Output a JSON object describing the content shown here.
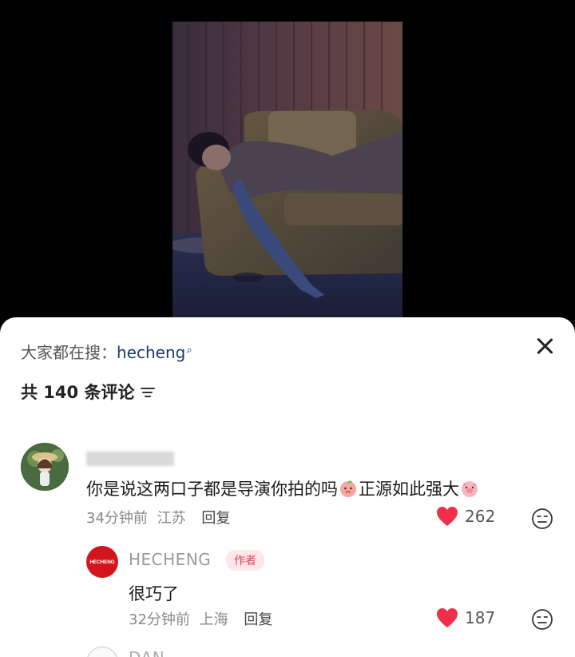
{
  "search_hint": {
    "prefix": "大家都在搜：",
    "keyword": "hecheng",
    "icon": "search-icon"
  },
  "comments_header": {
    "count_label": "共 140 条评论",
    "sort_icon": "sort-filter-icon"
  },
  "comments": [
    {
      "text_part1": "你是说这两口子都是导演你拍的吗",
      "text_part2": "正源如此强大",
      "time": "34分钟前",
      "location": "江苏",
      "reply_label": "回复",
      "likes": "262"
    }
  ],
  "reply": {
    "author": "HECHENG",
    "avatar_text": "HECHENG",
    "author_tag": "作者",
    "text": "很巧了",
    "time": "32分钟前",
    "location": "上海",
    "reply_label": "回复",
    "likes": "187"
  },
  "next_comment": {
    "name_partial": "DAN"
  },
  "colors": {
    "heart": "#f0304a",
    "author_tag_text": "#e0425a",
    "keyword": "#1e3a6b"
  }
}
